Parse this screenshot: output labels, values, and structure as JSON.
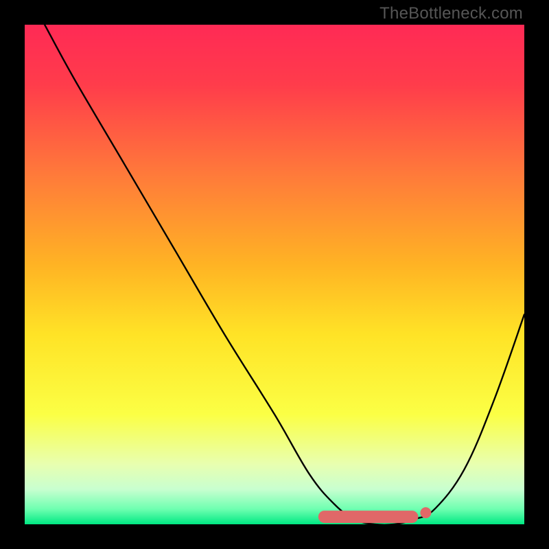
{
  "watermark": "TheBottleneck.com",
  "chart_data": {
    "type": "line",
    "title": "",
    "xlabel": "",
    "ylabel": "",
    "xlim": [
      0,
      100
    ],
    "ylim": [
      0,
      100
    ],
    "series": [
      {
        "name": "bottleneck-curve",
        "x": [
          4,
          10,
          20,
          30,
          40,
          50,
          57,
          62,
          66,
          70,
          74,
          78,
          82,
          88,
          94,
          100
        ],
        "y": [
          100,
          89,
          72,
          55,
          38,
          22,
          10,
          4,
          1,
          0,
          0,
          1,
          3,
          11,
          25,
          42
        ]
      }
    ],
    "highlight_band": {
      "name": "optimal-range",
      "x_start": 60,
      "x_end": 80,
      "y": 1.5
    },
    "gradient_stops": [
      {
        "pct": 0,
        "color": "#ff2a55"
      },
      {
        "pct": 12,
        "color": "#ff3c4b"
      },
      {
        "pct": 30,
        "color": "#ff7a3a"
      },
      {
        "pct": 48,
        "color": "#ffb324"
      },
      {
        "pct": 62,
        "color": "#ffe326"
      },
      {
        "pct": 78,
        "color": "#fbff45"
      },
      {
        "pct": 88,
        "color": "#e8ffb0"
      },
      {
        "pct": 93,
        "color": "#c8ffd0"
      },
      {
        "pct": 97,
        "color": "#6dffb0"
      },
      {
        "pct": 100,
        "color": "#00e882"
      }
    ]
  }
}
